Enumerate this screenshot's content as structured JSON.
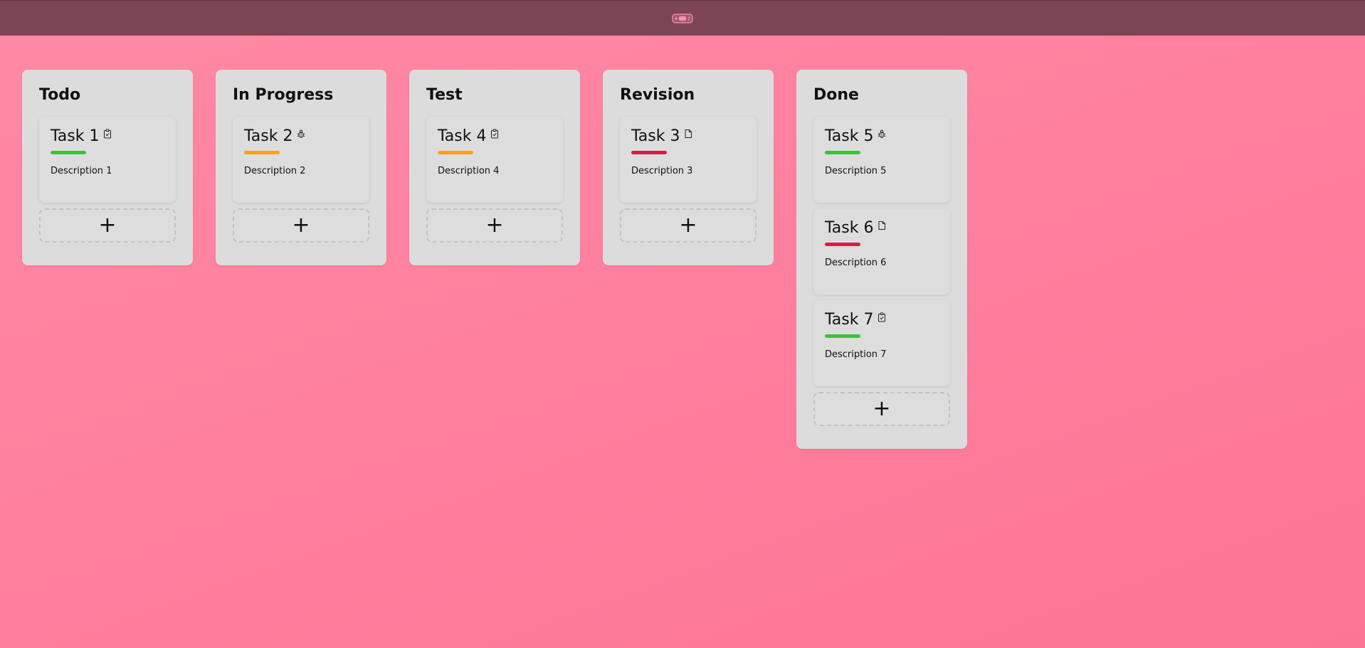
{
  "app": {
    "logo_icon": "gamepad-logo-icon"
  },
  "colors": {
    "low": "#3ac43a",
    "medium": "#f5a31a",
    "high": "#d81b45"
  },
  "columns": [
    {
      "title": "Todo",
      "add_label": "+",
      "cards": [
        {
          "title": "Task 1",
          "icon": "clipboard-check-icon",
          "priority": "low",
          "description": "Description 1"
        }
      ]
    },
    {
      "title": "In Progress",
      "add_label": "+",
      "cards": [
        {
          "title": "Task 2",
          "icon": "bug-icon",
          "priority": "medium",
          "description": "Description 2"
        }
      ]
    },
    {
      "title": "Test",
      "add_label": "+",
      "cards": [
        {
          "title": "Task 4",
          "icon": "clipboard-check-icon",
          "priority": "medium",
          "description": "Description 4"
        }
      ]
    },
    {
      "title": "Revision",
      "add_label": "+",
      "cards": [
        {
          "title": "Task 3",
          "icon": "document-icon",
          "priority": "high",
          "description": "Description 3"
        }
      ]
    },
    {
      "title": "Done",
      "add_label": "+",
      "cards": [
        {
          "title": "Task 5",
          "icon": "bug-icon",
          "priority": "low",
          "description": "Description 5"
        },
        {
          "title": "Task 6",
          "icon": "document-icon",
          "priority": "high",
          "description": "Description 6"
        },
        {
          "title": "Task 7",
          "icon": "clipboard-check-icon",
          "priority": "low",
          "description": "Description 7"
        }
      ]
    }
  ]
}
